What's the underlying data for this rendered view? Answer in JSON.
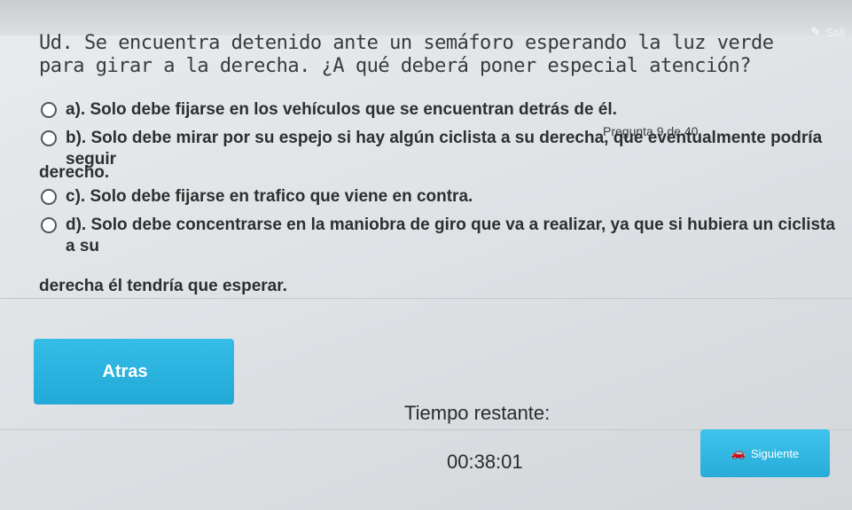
{
  "header": {
    "exit_label": "Sali",
    "exit_icon": "pencil-icon"
  },
  "question": {
    "text": "Ud. Se encuentra detenido ante un semáforo esperando la luz verde para girar a la derecha. ¿A qué deberá poner especial atención?",
    "counter": "Pregunta 9 de 40"
  },
  "options": [
    {
      "text": "a). Solo debe fijarse en los vehículos que se encuentran detrás de él."
    },
    {
      "text": "b). Solo debe mirar por su espejo si hay algún ciclista a su derecha, que eventualmente podría seguir"
    },
    {
      "text": "c). Solo debe fijarse en trafico que viene en contra."
    },
    {
      "text": "d). Solo debe concentrarse en la maniobra de giro que va a realizar, ya que si hubiera un ciclista a su"
    }
  ],
  "continuations": {
    "b": "derecho.",
    "d": "derecha él tendría que esperar."
  },
  "buttons": {
    "back_label": "Atras",
    "next_label": "Siguiente",
    "next_icon": "car-icon"
  },
  "timer": {
    "label": "Tiempo restante:",
    "value": "00:38:01"
  }
}
